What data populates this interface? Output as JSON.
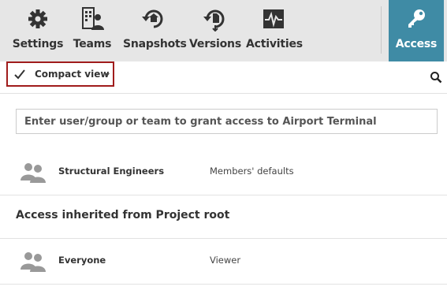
{
  "toolbar": {
    "items": [
      {
        "label": "Settings",
        "icon": "gear-icon"
      },
      {
        "label": "Teams",
        "icon": "teams-icon"
      },
      {
        "label": "Snapshots",
        "icon": "snapshots-icon"
      },
      {
        "label": "Versions",
        "icon": "versions-icon"
      },
      {
        "label": "Activities",
        "icon": "activities-icon"
      },
      {
        "label": "Access",
        "icon": "key-icon",
        "active": true
      }
    ],
    "active_color": "#3f8ba5"
  },
  "view": {
    "selected": "Compact view",
    "highlight_color": "#a01c1c"
  },
  "grant": {
    "placeholder": "Enter user/group or team to grant access to Airport Terminal"
  },
  "members": [
    {
      "name": "Structural Engineers",
      "role": "Members' defaults",
      "icon": "group-icon"
    }
  ],
  "inherited": {
    "title": "Access inherited from Project root",
    "members": [
      {
        "name": "Everyone",
        "role": "Viewer",
        "icon": "group-icon"
      }
    ]
  }
}
